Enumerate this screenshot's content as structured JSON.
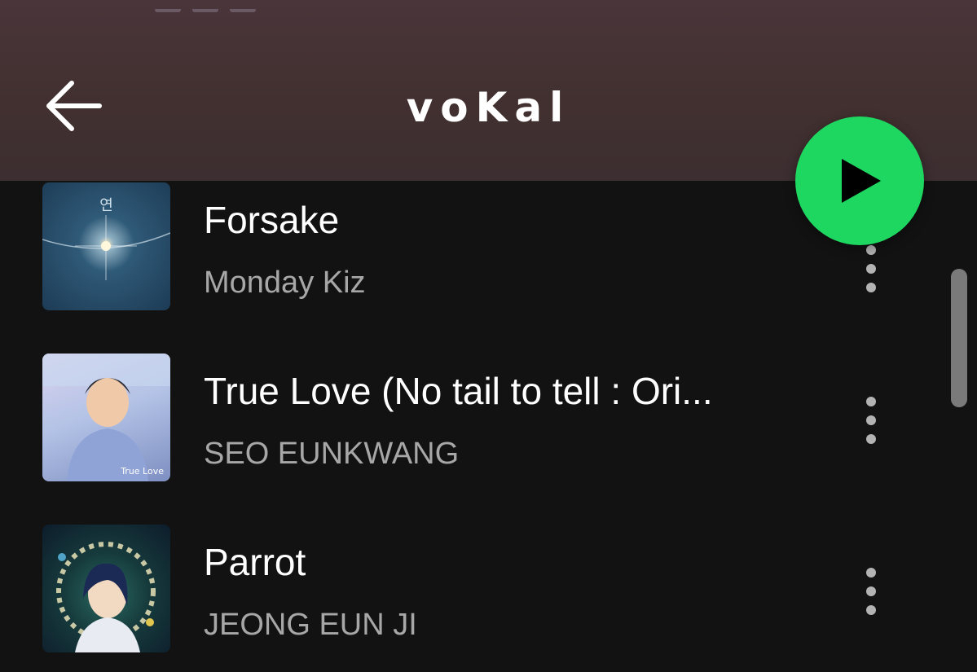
{
  "header": {
    "title": "voKal",
    "back_icon": "arrow-left-icon",
    "play_icon": "play-icon",
    "accent": "#1ed760",
    "background": "#4a353a"
  },
  "tracks": [
    {
      "title": "Forsake",
      "artist": "Monday Kiz",
      "art_text": "연",
      "art_colors": [
        "#1d3b55",
        "#2f5a78"
      ]
    },
    {
      "title": "True Love (No tail to tell : Ori...",
      "artist": "SEO EUNKWANG",
      "art_text": "True Love",
      "art_colors": [
        "#a9b7df",
        "#d7c8e8"
      ]
    },
    {
      "title": "Parrot",
      "artist": "JEONG EUN JI",
      "art_text": "",
      "art_colors": [
        "#0d1c2b",
        "#1d4f4a"
      ]
    }
  ],
  "more_icon": "more-vertical-icon"
}
